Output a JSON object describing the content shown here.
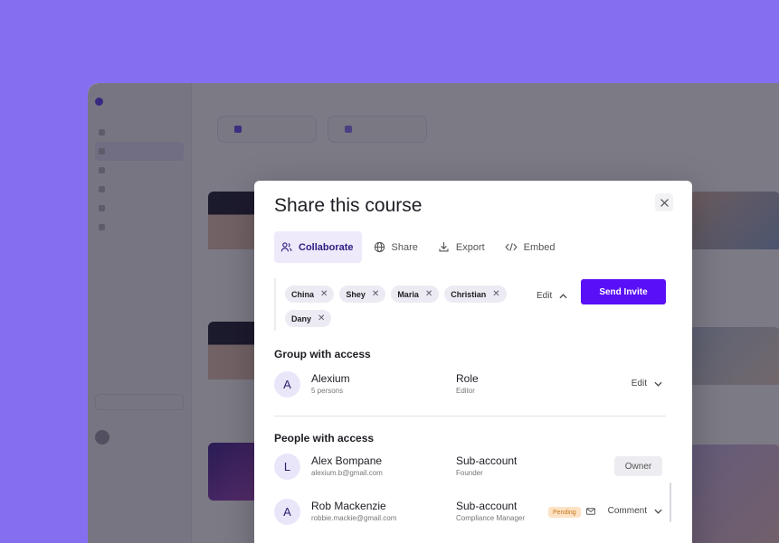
{
  "modal": {
    "title": "Share this course",
    "tabs": [
      {
        "label": "Collaborate",
        "icon": "users-icon",
        "active": true
      },
      {
        "label": "Share",
        "icon": "globe-icon",
        "active": false
      },
      {
        "label": "Export",
        "icon": "download-icon",
        "active": false
      },
      {
        "label": "Embed",
        "icon": "code-icon",
        "active": false
      }
    ],
    "invite": {
      "chips": [
        "China",
        "Shey",
        "Maria",
        "Christian",
        "Dany"
      ],
      "permission": "Edit",
      "send_label": "Send Invite"
    },
    "group_section": {
      "title": "Group with access",
      "entries": [
        {
          "initial": "A",
          "name": "Alexium",
          "detail": "5 persons",
          "role_title": "Role",
          "role_detail": "Editor",
          "permission": "Edit"
        }
      ]
    },
    "people_section": {
      "title": "People with access",
      "entries": [
        {
          "initial": "L",
          "name": "Alex Bompane",
          "email": "alexium.b@gmail.com",
          "role_title": "Sub-account",
          "role_detail": "Founder",
          "badge": "Owner"
        },
        {
          "initial": "A",
          "name": "Rob Mackenzie",
          "email": "robbie.mackie@gmail.com",
          "role_title": "Sub-account",
          "role_detail": "Compliance Manager",
          "status": "Pending",
          "permission": "Comment"
        }
      ]
    }
  },
  "colors": {
    "page_background": "#866ef0",
    "accent": "#5a10f6",
    "active_tab_bg": "#efeafb",
    "avatar_bg": "#e9e6fa",
    "pending_bg": "#fde2c4"
  }
}
